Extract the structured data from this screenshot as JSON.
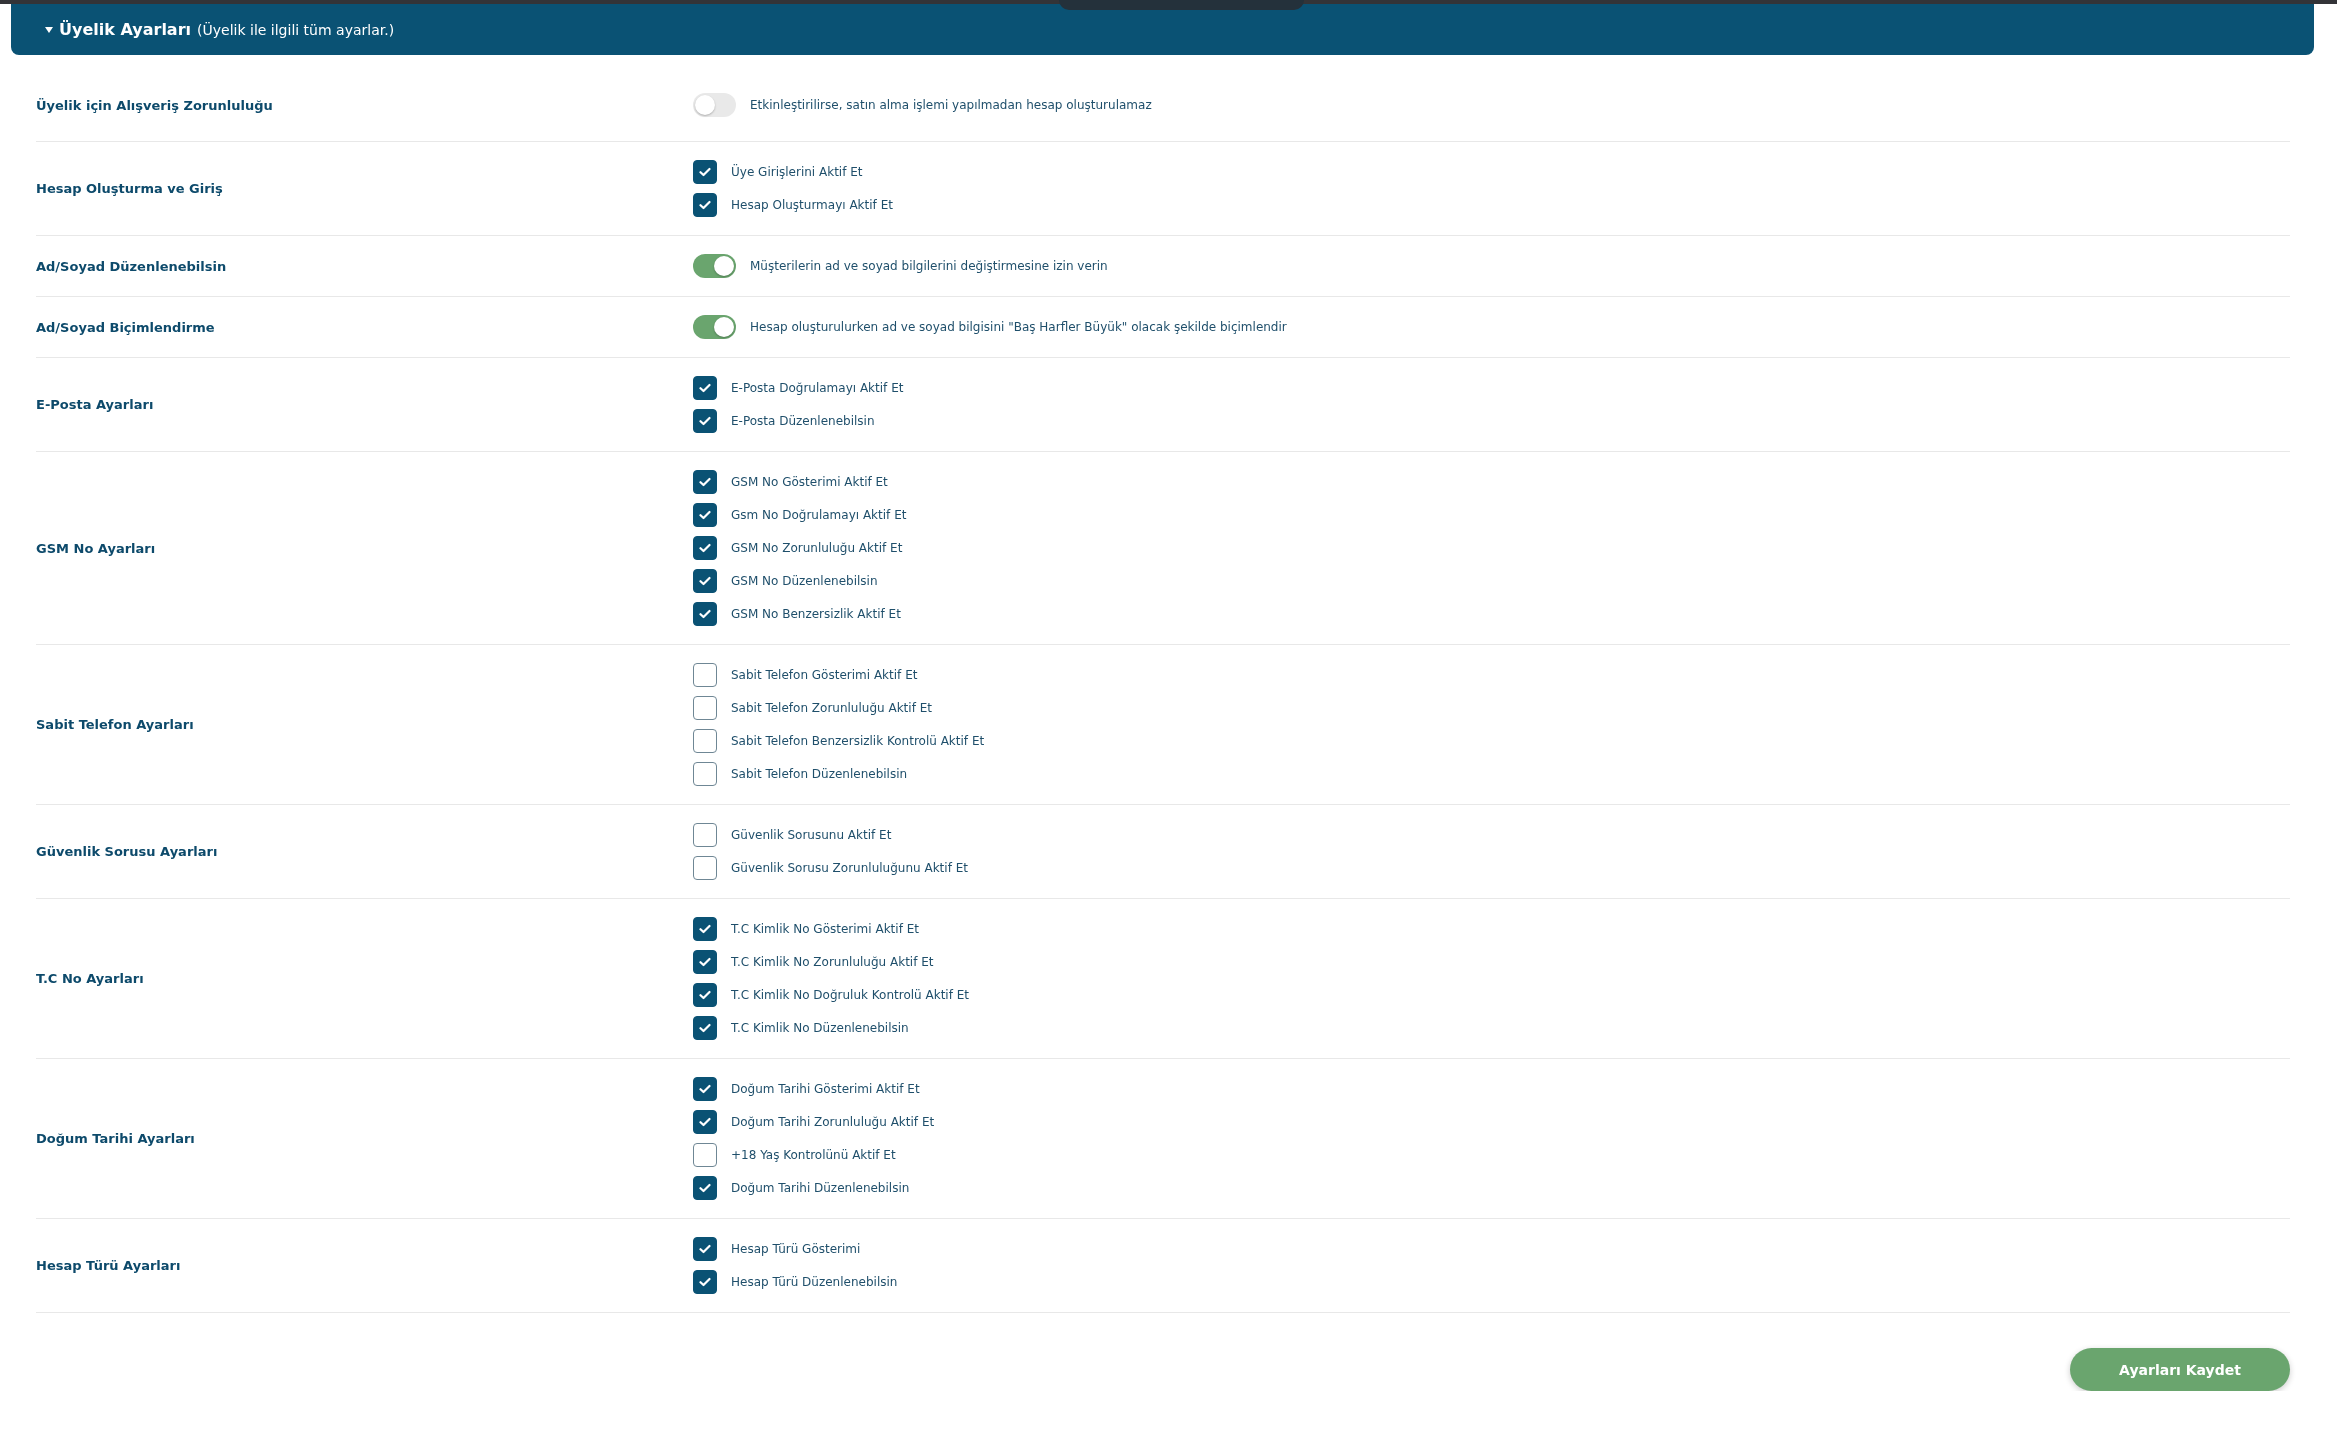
{
  "header": {
    "title": "Üyelik Ayarları",
    "subtitle": "(Üyelik ile ilgili tüm ayarlar.)",
    "expanded": true
  },
  "settings": [
    {
      "label": "Üyelik için Alışveriş Zorunluluğu",
      "kind": "toggle",
      "on": false,
      "description": "Etkinleştirilirse, satın alma işlemi yapılmadan hesap oluşturulamaz"
    },
    {
      "label": "Hesap Oluşturma ve Giriş",
      "kind": "checkboxes",
      "options": [
        {
          "label": "Üye Girişlerini Aktif Et",
          "checked": true
        },
        {
          "label": "Hesap Oluşturmayı Aktif Et",
          "checked": true
        }
      ]
    },
    {
      "label": "Ad/Soyad Düzenlenebilsin",
      "kind": "toggle",
      "on": true,
      "description": "Müşterilerin ad ve soyad bilgilerini değiştirmesine izin verin"
    },
    {
      "label": "Ad/Soyad Biçimlendirme",
      "kind": "toggle",
      "on": true,
      "description": "Hesap oluşturulurken ad ve soyad bilgisini \"Baş Harfler Büyük\" olacak şekilde biçimlendir"
    },
    {
      "label": "E-Posta Ayarları",
      "kind": "checkboxes",
      "options": [
        {
          "label": "E-Posta Doğrulamayı Aktif Et",
          "checked": true
        },
        {
          "label": "E-Posta Düzenlenebilsin",
          "checked": true
        }
      ]
    },
    {
      "label": "GSM No Ayarları",
      "kind": "checkboxes",
      "options": [
        {
          "label": "GSM No Gösterimi Aktif Et",
          "checked": true
        },
        {
          "label": "Gsm No Doğrulamayı Aktif Et",
          "checked": true
        },
        {
          "label": "GSM No Zorunluluğu Aktif Et",
          "checked": true
        },
        {
          "label": "GSM No Düzenlenebilsin",
          "checked": true
        },
        {
          "label": "GSM No Benzersizlik Aktif Et",
          "checked": true
        }
      ]
    },
    {
      "label": "Sabit Telefon Ayarları",
      "kind": "checkboxes",
      "options": [
        {
          "label": "Sabit Telefon Gösterimi Aktif Et",
          "checked": false
        },
        {
          "label": "Sabit Telefon Zorunluluğu Aktif Et",
          "checked": false
        },
        {
          "label": "Sabit Telefon Benzersizlik Kontrolü Aktif Et",
          "checked": false
        },
        {
          "label": "Sabit Telefon Düzenlenebilsin",
          "checked": false
        }
      ]
    },
    {
      "label": "Güvenlik Sorusu Ayarları",
      "kind": "checkboxes",
      "options": [
        {
          "label": "Güvenlik Sorusunu Aktif Et",
          "checked": false
        },
        {
          "label": "Güvenlik Sorusu Zorunluluğunu Aktif Et",
          "checked": false
        }
      ]
    },
    {
      "label": "T.C No Ayarları",
      "kind": "checkboxes",
      "options": [
        {
          "label": "T.C Kimlik No Gösterimi Aktif Et",
          "checked": true
        },
        {
          "label": "T.C Kimlik No Zorunluluğu Aktif Et",
          "checked": true
        },
        {
          "label": "T.C Kimlik No Doğruluk Kontrolü Aktif Et",
          "checked": true
        },
        {
          "label": "T.C Kimlik No Düzenlenebilsin",
          "checked": true
        }
      ]
    },
    {
      "label": "Doğum Tarihi Ayarları",
      "kind": "checkboxes",
      "options": [
        {
          "label": "Doğum Tarihi Gösterimi Aktif Et",
          "checked": true
        },
        {
          "label": "Doğum Tarihi Zorunluluğu Aktif Et",
          "checked": true
        },
        {
          "label": "+18 Yaş Kontrolünü Aktif Et",
          "checked": false
        },
        {
          "label": "Doğum Tarihi Düzenlenebilsin",
          "checked": true
        }
      ]
    },
    {
      "label": "Hesap Türü Ayarları",
      "kind": "checkboxes",
      "options": [
        {
          "label": "Hesap Türü Gösterimi",
          "checked": true
        },
        {
          "label": "Hesap Türü Düzenlenebilsin",
          "checked": true
        }
      ]
    }
  ],
  "save_button": "Ayarları Kaydet"
}
